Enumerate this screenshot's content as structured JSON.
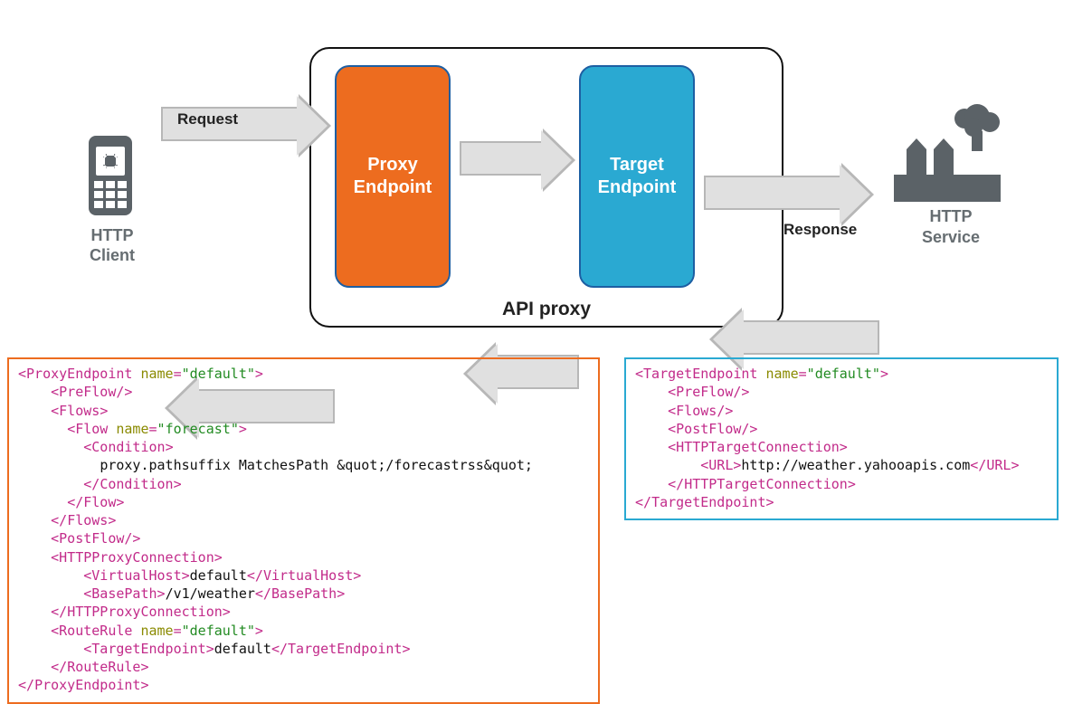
{
  "client_label": "HTTP\nClient",
  "service_label": "HTTP\nService",
  "api_proxy_title": "API proxy",
  "request_label": "Request",
  "response_label": "Response",
  "proxy_endpoint_label": "Proxy\nEndpoint",
  "target_endpoint_label": "Target\nEndpoint",
  "colors": {
    "proxy_orange": "#ed6c1f",
    "target_blue": "#2aa9d2",
    "icon_gray": "#5b6267",
    "arrow_fill": "#e0e0e0",
    "arrow_stroke": "#b7b7b7"
  },
  "proxy_endpoint_xml": {
    "root": {
      "tag": "ProxyEndpoint",
      "attr_name": "name",
      "attr_value": "default"
    },
    "preflow": "PreFlow",
    "flows_open": "Flows",
    "flow": {
      "tag": "Flow",
      "attr_name": "name",
      "attr_value": "forecast"
    },
    "condition_open": "Condition",
    "condition_text": "proxy.pathsuffix MatchesPath &quot;/forecastrss&quot;",
    "condition_close": "Condition",
    "flow_close": "Flow",
    "flows_close": "Flows",
    "postflow": "PostFlow",
    "http_conn_open": "HTTPProxyConnection",
    "virtualhost_tag": "VirtualHost",
    "virtualhost_text": "default",
    "basepath_tag": "BasePath",
    "basepath_text": "/v1/weather",
    "http_conn_close": "HTTPProxyConnection",
    "routerule": {
      "tag": "RouteRule",
      "attr_name": "name",
      "attr_value": "default"
    },
    "target_endpoint_tag": "TargetEndpoint",
    "target_endpoint_text": "default",
    "routerule_close": "RouteRule",
    "root_close": "ProxyEndpoint"
  },
  "target_endpoint_xml": {
    "root": {
      "tag": "TargetEndpoint",
      "attr_name": "name",
      "attr_value": "default"
    },
    "preflow": "PreFlow",
    "flows": "Flows",
    "postflow": "PostFlow",
    "http_conn_open": "HTTPTargetConnection",
    "url_tag": "URL",
    "url_text": "http://weather.yahooapis.com",
    "http_conn_close": "HTTPTargetConnection",
    "root_close": "TargetEndpoint"
  }
}
